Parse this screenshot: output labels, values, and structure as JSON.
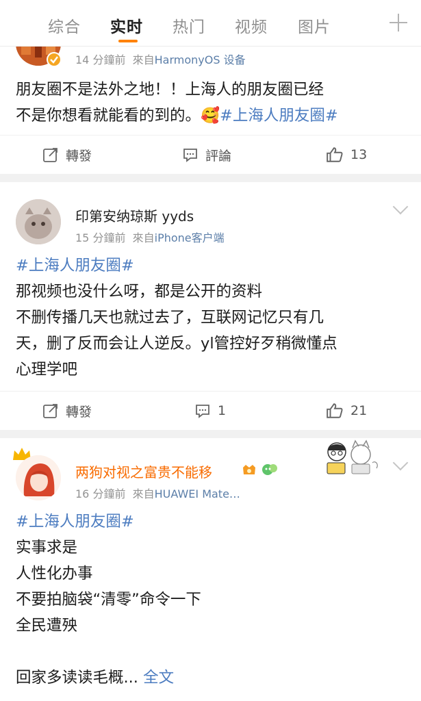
{
  "tabs": [
    {
      "label": "综合",
      "active": false
    },
    {
      "label": "实时",
      "active": true
    },
    {
      "label": "热门",
      "active": false
    },
    {
      "label": "视频",
      "active": false
    },
    {
      "label": "图片",
      "active": false
    }
  ],
  "accent_color": "#ff8200",
  "link_color": "#4c7cc0",
  "posts": [
    {
      "time": "14 分鐘前",
      "from": "來自",
      "source": "HarmonyOS 设备",
      "text_line1": "朋友圈不是法外之地！！上海人的朋友圈已经",
      "text_line2": "不是你想看就能看的到的。",
      "emoji": "🥰",
      "tag": "#上海人朋友圈#",
      "repost_label": "轉發",
      "comment_label": "評論",
      "like_count": "13"
    },
    {
      "username": "印第安纳琼斯 yyds",
      "time": "15 分鐘前",
      "from": "來自",
      "source": "iPhone客户端",
      "tag": "#上海人朋友圈#",
      "lines": [
        "那视频也没什么呀，都是公开的资料",
        "不删传播几天也就过去了，互联网记忆只有几",
        "天，删了反而会让人逆反。yl管控好歹稍微懂点",
        "心理学吧"
      ],
      "repost_label": "轉發",
      "comment_count": "1",
      "like_count": "21"
    },
    {
      "username": "两狗对视之富贵不能移",
      "time": "16 分鐘前",
      "from": "來自",
      "source": "HUAWEI Mate…",
      "tag": "#上海人朋友圈#",
      "lines": [
        "实事求是",
        "人性化办事",
        "不要拍脑袋“清零”命令一下",
        "全民遭殃",
        "",
        "回家多读读毛概..."
      ],
      "full_text_link": "全文"
    }
  ]
}
